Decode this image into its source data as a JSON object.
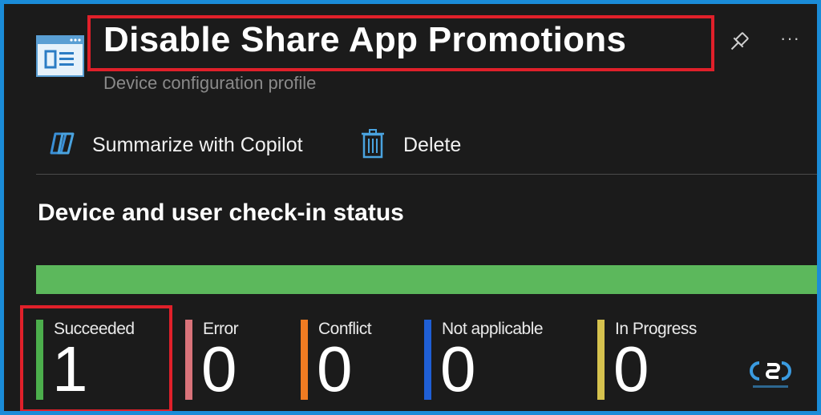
{
  "header": {
    "title": "Disable Share App Promotions",
    "subtitle": "Device configuration profile",
    "icons": {
      "app": "configuration-profile-icon",
      "pin": "pin-icon",
      "more": "more-options-icon"
    }
  },
  "toolbar": {
    "copilot_label": "Summarize with Copilot",
    "delete_label": "Delete",
    "icons": {
      "copilot": "copilot-icon",
      "delete": "trash-icon"
    }
  },
  "section": {
    "title": "Device and user check-in status"
  },
  "status_bar": {
    "succeeded_fraction": 1.0,
    "fill_color": "#5cb85c"
  },
  "stats": [
    {
      "label": "Succeeded",
      "value": "1",
      "color": "#4cae4c"
    },
    {
      "label": "Error",
      "value": "0",
      "color": "#d9737a"
    },
    {
      "label": "Conflict",
      "value": "0",
      "color": "#f07b22"
    },
    {
      "label": "Not applicable",
      "value": "0",
      "color": "#1f5fd6"
    },
    {
      "label": "In Progress",
      "value": "0",
      "color": "#d6c24e"
    }
  ],
  "colors": {
    "background": "#1b1b1b",
    "frame": "#1a8cd8",
    "highlight": "#e0202a",
    "accent": "#4aa3df"
  }
}
